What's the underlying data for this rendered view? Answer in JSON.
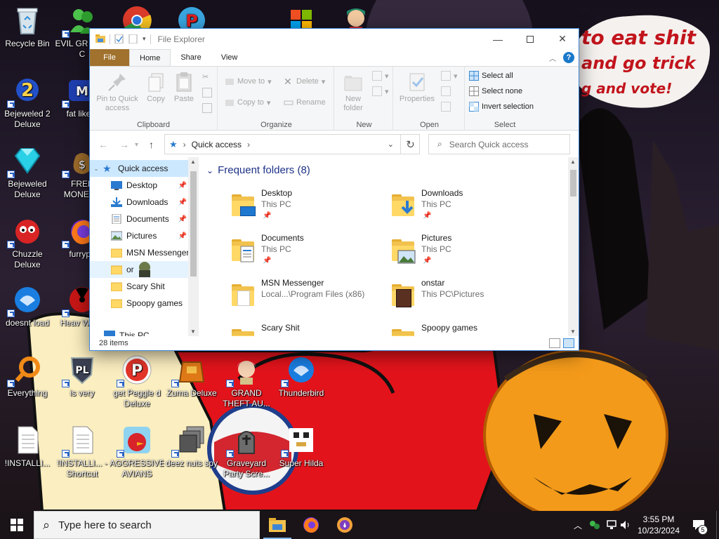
{
  "speech_bubble": {
    "line1": "to eat shit",
    "line2": "and go trick",
    "line3": "g and vote!"
  },
  "desktop_icons": [
    {
      "label": "Recycle Bin"
    },
    {
      "label": "Bejeweled 2 Deluxe"
    },
    {
      "label": "Bejeweled Deluxe"
    },
    {
      "label": "Chuzzle Deluxe"
    },
    {
      "label": "doesnt load"
    },
    {
      "label": "Everything"
    },
    {
      "label": "!INSTALLI..."
    },
    {
      "label": "EVIL GR MEN C"
    },
    {
      "label": "fat like d"
    },
    {
      "label": "FREE MONEY..."
    },
    {
      "label": "furrypo"
    },
    {
      "label": "Heav Weap"
    },
    {
      "label": "is very"
    },
    {
      "label": "!INSTALLI... - Shortcut"
    },
    {
      "label": "get Peggle d Deluxe"
    },
    {
      "label": "Zuma Deluxe"
    },
    {
      "label": "GRAND THEFT AU..."
    },
    {
      "label": "Thunderbird"
    },
    {
      "label": "AGGRESSIVE AVIANS"
    },
    {
      "label": "deez nuts spy"
    },
    {
      "label": "Graveyard Party Scre..."
    },
    {
      "label": "Super Hilda"
    }
  ],
  "explorer": {
    "title": "File Explorer",
    "tabs": {
      "file": "File",
      "home": "Home",
      "share": "Share",
      "view": "View"
    },
    "ribbon": {
      "clipboard": {
        "pin": "Pin to Quick access",
        "copy": "Copy",
        "paste": "Paste",
        "group": "Clipboard"
      },
      "organize": {
        "move_to": "Move to",
        "copy_to": "Copy to",
        "delete": "Delete",
        "rename": "Rename",
        "group": "Organize"
      },
      "new": {
        "new_folder": "New folder",
        "group": "New"
      },
      "open": {
        "properties": "Properties",
        "group": "Open"
      },
      "select": {
        "select_all": "Select all",
        "select_none": "Select none",
        "invert": "Invert selection",
        "group": "Select"
      }
    },
    "address": {
      "location": "Quick access",
      "search_placeholder": "Search Quick access"
    },
    "nav": [
      {
        "label": "Quick access"
      },
      {
        "label": "Desktop"
      },
      {
        "label": "Downloads"
      },
      {
        "label": "Documents"
      },
      {
        "label": "Pictures"
      },
      {
        "label": "MSN Messenger"
      },
      {
        "label": "or"
      },
      {
        "label": "Scary Shit"
      },
      {
        "label": "Spoopy games"
      },
      {
        "label": "This PC"
      }
    ],
    "section_title": "Frequent folders (8)",
    "tiles": [
      {
        "name": "Desktop",
        "path": "This PC"
      },
      {
        "name": "Downloads",
        "path": "This PC"
      },
      {
        "name": "Documents",
        "path": "This PC"
      },
      {
        "name": "Pictures",
        "path": "This PC"
      },
      {
        "name": "MSN Messenger",
        "path": "Local...\\Program Files (x86)"
      },
      {
        "name": "onstar",
        "path": "This PC\\Pictures"
      },
      {
        "name": "Scary Shit",
        "path": ""
      },
      {
        "name": "Spoopy games",
        "path": ""
      }
    ],
    "status": "28 items"
  },
  "taskbar": {
    "search_placeholder": "Type here to search",
    "time": "3:55 PM",
    "date": "10/23/2024",
    "notifications": "5"
  },
  "colors": {
    "accent": "#1979ca",
    "file_tab": "#a0722e",
    "folder": "#ffd866",
    "taskbar": "#1a1419"
  }
}
